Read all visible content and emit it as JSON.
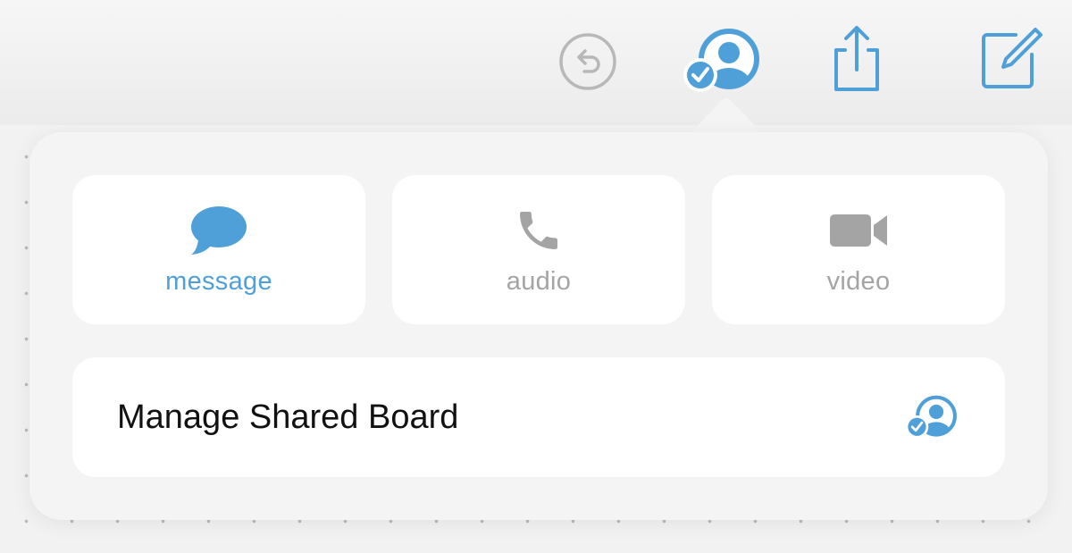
{
  "colors": {
    "accent": "#4f9fd8",
    "disabled": "#a4a4a4",
    "text": "#111111"
  },
  "toolbar": {
    "undo_icon": "undo-arrow-icon",
    "collaborate_icon": "shared-person-check-icon",
    "share_icon": "share-icon",
    "compose_icon": "compose-icon"
  },
  "popover": {
    "actions": [
      {
        "label": "message",
        "icon": "message-bubble-icon",
        "active": true
      },
      {
        "label": "audio",
        "icon": "phone-icon",
        "active": false
      },
      {
        "label": "video",
        "icon": "video-camera-icon",
        "active": false
      }
    ],
    "manage": {
      "label": "Manage Shared Board",
      "icon": "shared-person-check-icon"
    }
  }
}
